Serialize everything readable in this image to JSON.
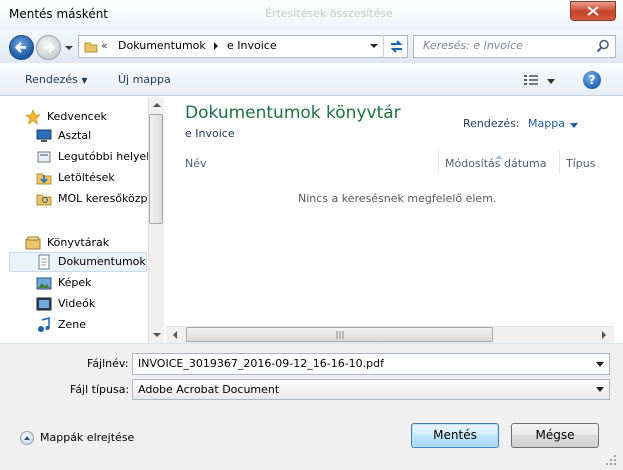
{
  "window": {
    "title": "Mentés másként",
    "ghost_title": "Értesítések összesítése"
  },
  "nav": {
    "breadcrumb_chevron": "«",
    "breadcrumb": [
      "Dokumentumok",
      "e Invoice"
    ],
    "search_placeholder": "Keresés: e Invoice"
  },
  "toolbar": {
    "organize_label": "Rendezés",
    "new_folder_label": "Új mappa",
    "help_label": "?"
  },
  "sidebar": {
    "groups": [
      {
        "label": "Kedvencek",
        "icon": "star-icon",
        "items": [
          {
            "label": "Asztal",
            "icon": "desktop-icon"
          },
          {
            "label": "Legutóbbi helyek",
            "icon": "recent-places-icon"
          },
          {
            "label": "Letöltések",
            "icon": "downloads-icon"
          },
          {
            "label": "MOL keresőközp",
            "icon": "search-folder-icon"
          }
        ]
      },
      {
        "label": "Könyvtárak",
        "icon": "libraries-icon",
        "items": [
          {
            "label": "Dokumentumok",
            "icon": "documents-icon",
            "selected": true
          },
          {
            "label": "Képek",
            "icon": "pictures-icon"
          },
          {
            "label": "Videók",
            "icon": "videos-icon"
          },
          {
            "label": "Zene",
            "icon": "music-icon"
          }
        ]
      }
    ]
  },
  "content": {
    "library_title": "Dokumentumok könyvtár",
    "library_subtitle": "e Invoice",
    "arrange_label": "Rendezés:",
    "arrange_value": "Mappa",
    "columns": [
      "Név",
      "Módosítás dátuma",
      "Típus"
    ],
    "empty_message": "Nincs a keresésnek megfelelő elem."
  },
  "form": {
    "filename_label": "Fájlnév:",
    "filename_value": "INVOICE_3019367_2016-09-12_16-16-10.pdf",
    "filetype_label": "Fájl típusa:",
    "filetype_value": "Adobe Acrobat Document"
  },
  "footer": {
    "hide_folders_label": "Mappák elrejtése",
    "save_label": "Mentés",
    "cancel_label": "Mégse"
  },
  "colors": {
    "library_title": "#1e7145",
    "link_blue": "#1e395b",
    "selection": "#eaf2fb"
  }
}
